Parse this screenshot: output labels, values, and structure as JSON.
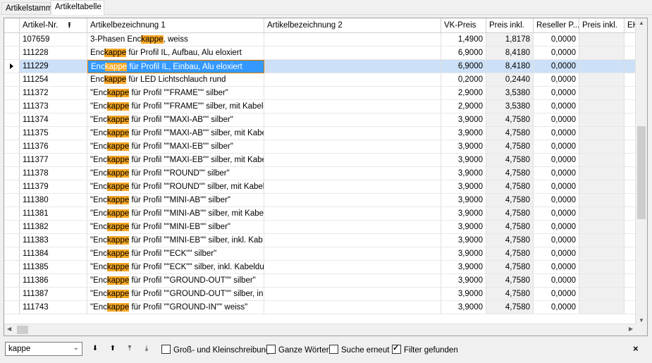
{
  "tabs": [
    {
      "label": "Artikelstamm"
    },
    {
      "label": "Artikeltabelle"
    }
  ],
  "columns": [
    "Artikel-Nr.",
    "Artikelbezeichnung 1",
    "Artikelbezeichnung 2",
    "VK-Preis",
    "Preis inkl.",
    "Reseller P...",
    "Preis inkl.",
    "EK"
  ],
  "rows": [
    {
      "nr": "107659",
      "pre": "3-Phasen Enc",
      "hl": "kappe",
      "post": ", weiss",
      "vk": "1,4900",
      "inkl": "1,8178",
      "res": "0,0000"
    },
    {
      "nr": "111228",
      "pre": "Enc",
      "hl": "kappe",
      "post": " für Profil IL, Aufbau, Alu eloxiert",
      "vk": "6,9000",
      "inkl": "8,4180",
      "res": "0,0000"
    },
    {
      "nr": "111229",
      "pre": "Enc",
      "hl": "kappe",
      "post": " für Profil IL, Einbau, Alu eloxiert",
      "vk": "6,9000",
      "inkl": "8,4180",
      "res": "0,0000",
      "selected": true
    },
    {
      "nr": "111254",
      "pre": "Enc",
      "hl": "kappe",
      "post": " für LED Lichtschlauch rund",
      "vk": "0,2000",
      "inkl": "0,2440",
      "res": "0,0000"
    },
    {
      "nr": "111372",
      "pre": "\"Enc",
      "hl": "kappe",
      "post": " für Profil \"\"FRAME\"\" silber\"",
      "vk": "2,9000",
      "inkl": "3,5380",
      "res": "0,0000"
    },
    {
      "nr": "111373",
      "pre": "\"Enc",
      "hl": "kappe",
      "post": " für Profil \"\"FRAME\"\" silber, mit Kabeldu",
      "vk": "2,9000",
      "inkl": "3,5380",
      "res": "0,0000"
    },
    {
      "nr": "111374",
      "pre": "\"Enc",
      "hl": "kappe",
      "post": " für Profil \"\"MAXI-AB\"\" silber\"",
      "vk": "3,9000",
      "inkl": "4,7580",
      "res": "0,0000"
    },
    {
      "nr": "111375",
      "pre": "\"Enc",
      "hl": "kappe",
      "post": " für Profil \"\"MAXI-AB\"\" silber, mit Kabel",
      "vk": "3,9000",
      "inkl": "4,7580",
      "res": "0,0000"
    },
    {
      "nr": "111376",
      "pre": "\"Enc",
      "hl": "kappe",
      "post": " für Profil \"\"MAXI-EB\"\" silber\"",
      "vk": "3,9000",
      "inkl": "4,7580",
      "res": "0,0000"
    },
    {
      "nr": "111377",
      "pre": "\"Enc",
      "hl": "kappe",
      "post": " für Profil \"\"MAXI-EB\"\" silber, mit Kabel",
      "vk": "3,9000",
      "inkl": "4,7580",
      "res": "0,0000"
    },
    {
      "nr": "111378",
      "pre": "\"Enc",
      "hl": "kappe",
      "post": " für Profil \"\"ROUND\"\" silber\"",
      "vk": "3,9000",
      "inkl": "4,7580",
      "res": "0,0000"
    },
    {
      "nr": "111379",
      "pre": "\"Enc",
      "hl": "kappe",
      "post": " für Profil \"\"ROUND\"\" silber, mit Kabeldu",
      "vk": "3,9000",
      "inkl": "4,7580",
      "res": "0,0000"
    },
    {
      "nr": "111380",
      "pre": "\"Enc",
      "hl": "kappe",
      "post": " für Profil \"\"MINI-AB\"\" silber\"",
      "vk": "3,9000",
      "inkl": "4,7580",
      "res": "0,0000"
    },
    {
      "nr": "111381",
      "pre": "\"Enc",
      "hl": "kappe",
      "post": " für Profil \"\"MINI-AB\"\" silber, mit Kabel",
      "vk": "3,9000",
      "inkl": "4,7580",
      "res": "0,0000"
    },
    {
      "nr": "111382",
      "pre": "\"Enc",
      "hl": "kappe",
      "post": " für Profil \"\"MINI-EB\"\" silber\"",
      "vk": "3,9000",
      "inkl": "4,7580",
      "res": "0,0000"
    },
    {
      "nr": "111383",
      "pre": "\"Enc",
      "hl": "kappe",
      "post": " für Profil \"\"MINI-EB\"\" silber, inkl. Kab",
      "vk": "3,9000",
      "inkl": "4,7580",
      "res": "0,0000"
    },
    {
      "nr": "111384",
      "pre": "\"Enc",
      "hl": "kappe",
      "post": " für Profil \"\"ECK\"\" silber\"",
      "vk": "3,9000",
      "inkl": "4,7580",
      "res": "0,0000"
    },
    {
      "nr": "111385",
      "pre": "\"Enc",
      "hl": "kappe",
      "post": " für Profil \"\"ECK\"\" silber, inkl. Kabeldu",
      "vk": "3,9000",
      "inkl": "4,7580",
      "res": "0,0000"
    },
    {
      "nr": "111386",
      "pre": "\"Enc",
      "hl": "kappe",
      "post": " für Profil \"\"GROUND-OUT\"\" silber\"",
      "vk": "3,9000",
      "inkl": "4,7580",
      "res": "0,0000"
    },
    {
      "nr": "111387",
      "pre": "\"Enc",
      "hl": "kappe",
      "post": " für Profil \"\"GROUND-OUT\"\" silber, inkl.",
      "vk": "3,9000",
      "inkl": "4,7580",
      "res": "0,0000"
    },
    {
      "nr": "111743",
      "pre": "\"Enc",
      "hl": "kappe",
      "post": " für Profil \"\"GROUND-IN\"\" weiss\"",
      "vk": "3,9000",
      "inkl": "4,7580",
      "res": "0,0000"
    }
  ],
  "search": {
    "value": "kappe",
    "options": [
      {
        "label": "Groß- und Kleinschreibung",
        "checked": false
      },
      {
        "label": "Ganze Wörter",
        "checked": false
      },
      {
        "label": "Suche erneut",
        "checked": false
      },
      {
        "label": "Filter gefunden",
        "checked": true
      }
    ],
    "close": "×"
  },
  "nav_icons": [
    "arrow-down-icon",
    "arrow-up-icon",
    "first-icon",
    "last-icon"
  ],
  "colors": {
    "highlight": "#f5a623",
    "selection": "#cce0f7",
    "focus": "#3399ff"
  }
}
